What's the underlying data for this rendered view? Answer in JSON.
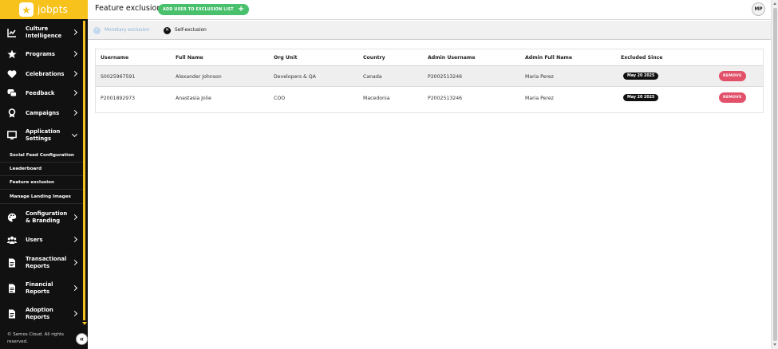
{
  "app": {
    "logo_text": "jobpts",
    "footer": "© Semos Cloud. All rights reserved.",
    "collapse_glyph": "«"
  },
  "sidebar": {
    "items": [
      {
        "label": "Culture Intelligence",
        "icon": "chart-icon"
      },
      {
        "label": "Programs",
        "icon": "star-icon"
      },
      {
        "label": "Celebrations",
        "icon": "heart-icon"
      },
      {
        "label": "Feedback",
        "icon": "chat-icon"
      },
      {
        "label": "Campaigns",
        "icon": "award-icon"
      },
      {
        "label": "Application Settings",
        "icon": "monitor-icon"
      },
      {
        "label": "Configuration & Branding",
        "icon": "palette-icon"
      },
      {
        "label": "Users",
        "icon": "users-icon"
      },
      {
        "label": "Transactional Reports",
        "icon": "document-icon"
      },
      {
        "label": "Financial Reports",
        "icon": "document-icon"
      },
      {
        "label": "Adoption Reports",
        "icon": "document-icon"
      }
    ],
    "sub_items": [
      {
        "label": "Social Feed Configuration"
      },
      {
        "label": "Leaderboard"
      },
      {
        "label": "Feature exclusion"
      },
      {
        "label": "Manage Landing Images"
      }
    ],
    "accent_color": "#f6c21b"
  },
  "header": {
    "title": "Feature exclusion",
    "add_button_label": "ADD USER TO EXCLUSION LIST",
    "add_button_glyph": "+",
    "avatar_initials": "MP",
    "add_button_color": "#49c16c"
  },
  "tabs": [
    {
      "label": "Monetary exclusion",
      "icon": "check-circle-icon",
      "glyph": "✓"
    },
    {
      "label": "Self-exclusion",
      "icon": "close-circle-icon",
      "glyph": "✕"
    }
  ],
  "table": {
    "columns": [
      "Username",
      "Full Name",
      "Org Unit",
      "Country",
      "Admin Username",
      "Admin Full Name",
      "Excluded Since"
    ],
    "remove_label": "REMOVE",
    "remove_color": "#e2506a",
    "rows": [
      {
        "username": "S0025967591",
        "full_name": "Alexander Johnson",
        "org_unit": "Developers & QA",
        "country": "Canada",
        "admin_username": "P2002513246",
        "admin_full_name": "Maria Perez",
        "excluded_since": "May 20 2025"
      },
      {
        "username": "P2001892973",
        "full_name": "Anastasia Jolie",
        "org_unit": "COO",
        "country": "Macedonia",
        "admin_username": "P2002513246",
        "admin_full_name": "Maria Perez",
        "excluded_since": "May 20 2025"
      }
    ]
  }
}
